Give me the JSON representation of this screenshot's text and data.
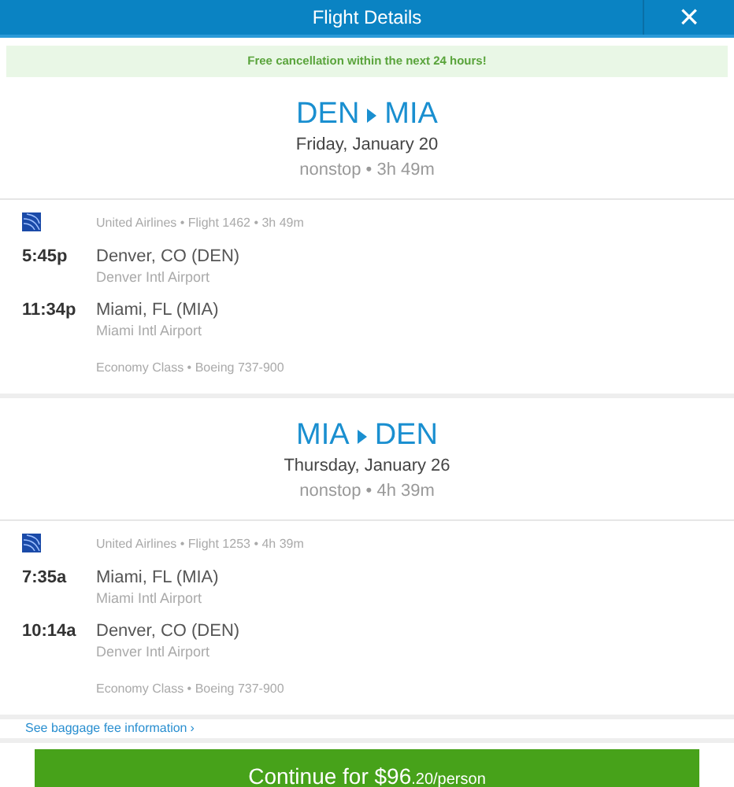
{
  "header": {
    "title": "Flight Details",
    "close": "×"
  },
  "notice": "Free cancellation within the next 24 hours!",
  "legs": [
    {
      "origin": "DEN",
      "destination": "MIA",
      "date": "Friday, January 20",
      "summary": "nonstop • 3h 49m",
      "flight": "United Airlines • Flight 1462 • 3h 49m",
      "stops": [
        {
          "time": "5:45p",
          "city": "Denver, CO (DEN)",
          "airport": "Denver Intl Airport"
        },
        {
          "time": "11:34p",
          "city": "Miami, FL (MIA)",
          "airport": "Miami Intl Airport"
        }
      ],
      "cabin": "Economy Class • Boeing 737-900"
    },
    {
      "origin": "MIA",
      "destination": "DEN",
      "date": "Thursday, January 26",
      "summary": "nonstop • 4h 39m",
      "flight": "United Airlines • Flight 1253 • 4h 39m",
      "stops": [
        {
          "time": "7:35a",
          "city": "Miami, FL (MIA)",
          "airport": "Miami Intl Airport"
        },
        {
          "time": "10:14a",
          "city": "Denver, CO (DEN)",
          "airport": "Denver Intl Airport"
        }
      ],
      "cabin": "Economy Class • Boeing 737-900"
    }
  ],
  "baggage_link": "See baggage fee information",
  "baggage_chevron": "›",
  "continue_button": {
    "label": "Continue for $96",
    "suffix": ".20/person"
  }
}
